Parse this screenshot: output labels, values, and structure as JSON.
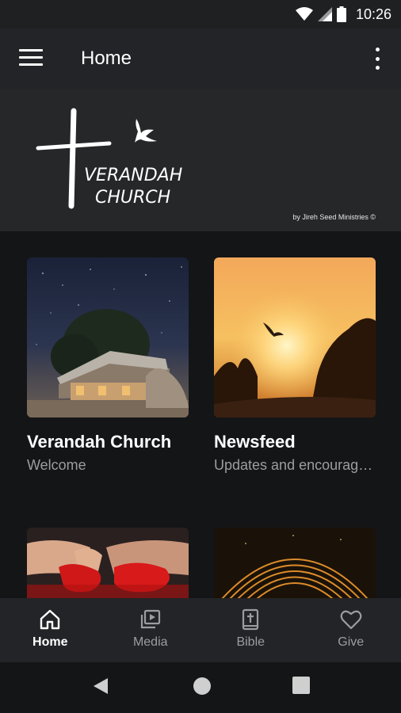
{
  "status_bar": {
    "time": "10:26",
    "icons": [
      "wifi-icon",
      "signal-icon",
      "battery-icon"
    ]
  },
  "app_bar": {
    "title": "Home",
    "left_icon": "hamburger-menu-icon",
    "right_icon": "more-vert-icon"
  },
  "banner": {
    "logo_line1": "VERANDAH",
    "logo_line2": "CHURCH",
    "byline": "by Jireh Seed Ministries ©"
  },
  "cards": [
    {
      "title": "Verandah Church",
      "subtitle": "Welcome",
      "image": "farmhouse-night-sky"
    },
    {
      "title": "Newsfeed",
      "subtitle": "Updates and encouragement",
      "image": "eagle-sunset"
    },
    {
      "title": "",
      "subtitle": "",
      "image": "hands-red-petals"
    },
    {
      "title": "",
      "subtitle": "",
      "image": "light-arcs"
    }
  ],
  "bottom_nav": {
    "items": [
      {
        "label": "Home",
        "icon": "home-icon",
        "active": true
      },
      {
        "label": "Media",
        "icon": "media-icon",
        "active": false
      },
      {
        "label": "Bible",
        "icon": "bible-icon",
        "active": false
      },
      {
        "label": "Give",
        "icon": "heart-icon",
        "active": false
      }
    ]
  },
  "system_nav": [
    "back-icon",
    "home-circle-icon",
    "recents-icon"
  ],
  "colors": {
    "background": "#141517",
    "bar": "#232427",
    "text_secondary": "#9c9da1"
  }
}
